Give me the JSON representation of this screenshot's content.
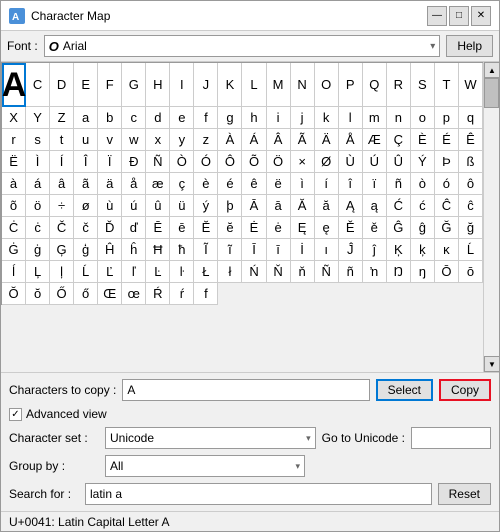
{
  "window": {
    "title": "Character Map",
    "icon": "🔤"
  },
  "title_buttons": {
    "minimize": "—",
    "maximize": "□",
    "close": "✕"
  },
  "toolbar": {
    "font_label": "Font :",
    "font_value": "Arial",
    "help_label": "Help"
  },
  "characters": [
    "C",
    "D",
    "E",
    "F",
    "G",
    "H",
    "I",
    "J",
    "K",
    "L",
    "M",
    "N",
    "O",
    "P",
    "Q",
    "R",
    "S",
    "T",
    "W",
    "X",
    "Y",
    "Z",
    "a",
    "b",
    "c",
    "d",
    "e",
    "f",
    "g",
    "h",
    "i",
    "j",
    "k",
    "l",
    "m",
    "n",
    "o",
    "p",
    "q",
    "r",
    "s",
    "t",
    "u",
    "v",
    "w",
    "x",
    "y",
    "z",
    "À",
    "Á",
    "Â",
    "Ã",
    "Ä",
    "Å",
    "Æ",
    "Ç",
    "È",
    "É",
    "Ê",
    "Ë",
    "Ì",
    "Í",
    "Î",
    "Ï",
    "Ð",
    "Ñ",
    "Ò",
    "Ó",
    "Ô",
    "Õ",
    "Ö",
    "×",
    "Ø",
    "Ù",
    "Ú",
    "Û",
    "Ý",
    "Þ",
    "ß",
    "à",
    "á",
    "â",
    "ã",
    "ä",
    "å",
    "æ",
    "ç",
    "è",
    "é",
    "ê",
    "ë",
    "ì",
    "í",
    "î",
    "ï",
    "ñ",
    "ò",
    "ó",
    "ô",
    "õ",
    "ö",
    "÷",
    "ø",
    "ù",
    "ú",
    "û",
    "ü",
    "ý",
    "þ",
    "Ā",
    "ā",
    "Ă",
    "ă",
    "Ą",
    "ą",
    "Ć",
    "ć",
    "Ĉ",
    "ĉ",
    "Ċ",
    "ċ",
    "Č",
    "č",
    "Ď",
    "ď",
    "Ē",
    "ē",
    "Ĕ",
    "ĕ",
    "Ė",
    "ė",
    "Ę",
    "ę",
    "Ě",
    "ě",
    "Ĝ",
    "ĝ",
    "Ğ",
    "ğ",
    "Ġ",
    "ġ",
    "Ģ",
    "ģ",
    "Ĥ",
    "ĥ",
    "Ħ",
    "ħ",
    "Ĩ",
    "ĩ",
    "Ī",
    "ī",
    "İ",
    "ı",
    "Ĵ",
    "ĵ",
    "Ķ",
    "ķ",
    "ĸ",
    "Ĺ",
    "ĺ",
    "Ļ",
    "ļ",
    "Ĺ",
    "Ľ",
    "ľ",
    "Ŀ",
    "ŀ",
    "Ł",
    "ł",
    "Ń",
    "Ň",
    "ň",
    "Ñ",
    "ñ",
    "ŉ",
    "Ŋ",
    "ŋ",
    "Ō",
    "ō",
    "Ŏ",
    "ŏ",
    "Ő",
    "ő",
    "Œ",
    "œ",
    "Ŕ",
    "ŕ",
    "f"
  ],
  "bottom": {
    "copy_label": "Characters to copy :",
    "copy_value": "A",
    "select_label": "Select",
    "copy_btn_label": "Copy",
    "advanced_label": "Advanced view",
    "charset_label": "Character set :",
    "charset_value": "Unicode",
    "go_unicode_label": "Go to Unicode :",
    "go_unicode_value": "",
    "group_label": "Group by :",
    "group_value": "All",
    "search_label": "Search for :",
    "search_value": "latin a",
    "reset_label": "Reset"
  },
  "status": {
    "text": "U+0041: Latin Capital Letter A"
  }
}
